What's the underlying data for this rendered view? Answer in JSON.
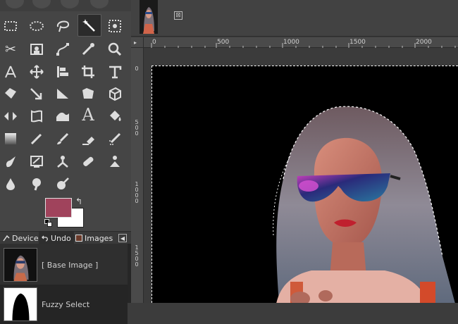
{
  "colors": {
    "foreground": "#a0435c",
    "background": "#ffffff",
    "canvas": "#000000",
    "panel": "#454545"
  },
  "toolbox": {
    "tools": [
      {
        "name": "rect-select-icon"
      },
      {
        "name": "ellipse-select-icon"
      },
      {
        "name": "free-select-icon"
      },
      {
        "name": "fuzzy-select-icon",
        "active": true
      },
      {
        "name": "select-by-color-icon"
      },
      {
        "name": "scissors-select-icon"
      },
      {
        "name": "foreground-select-icon"
      },
      {
        "name": "paths-icon"
      },
      {
        "name": "color-picker-icon"
      },
      {
        "name": "zoom-icon"
      },
      {
        "name": "measure-icon"
      },
      {
        "name": "move-icon"
      },
      {
        "name": "align-icon"
      },
      {
        "name": "crop-icon"
      },
      {
        "name": "unified-transform-icon"
      },
      {
        "name": "warp-transform-icon"
      },
      {
        "name": "handle-transform-icon"
      },
      {
        "name": "flip-icon"
      },
      {
        "name": "cage-transform-icon"
      },
      {
        "name": "perspective-icon"
      },
      {
        "name": "flip-horizontal-icon"
      },
      {
        "name": "transform-grid-icon"
      },
      {
        "name": "smudge-warp-icon"
      },
      {
        "name": "text-icon"
      },
      {
        "name": "bucket-fill-icon"
      },
      {
        "name": "gradient-icon"
      },
      {
        "name": "pencil-icon"
      },
      {
        "name": "paintbrush-icon"
      },
      {
        "name": "eraser-icon"
      },
      {
        "name": "airbrush-icon"
      },
      {
        "name": "ink-icon"
      },
      {
        "name": "mypaint-brush-icon"
      },
      {
        "name": "clone-icon"
      },
      {
        "name": "heal-icon"
      },
      {
        "name": "perspective-clone-icon"
      },
      {
        "name": "blur-icon"
      },
      {
        "name": "smudge-icon"
      },
      {
        "name": "dodge-burn-icon"
      }
    ]
  },
  "dock": {
    "tabs": [
      {
        "label": "Devices"
      },
      {
        "label": "Undo"
      },
      {
        "label": "Images"
      }
    ]
  },
  "undo": {
    "items": [
      {
        "label": "[ Base Image ]"
      },
      {
        "label": "Fuzzy Select"
      }
    ]
  },
  "image_window": {
    "close_glyph": "⊠"
  },
  "ruler": {
    "h_labels": [
      "0",
      "500",
      "1000",
      "1500",
      "2000"
    ],
    "v_labels": [
      "0",
      "500",
      "1000",
      "1500"
    ]
  }
}
